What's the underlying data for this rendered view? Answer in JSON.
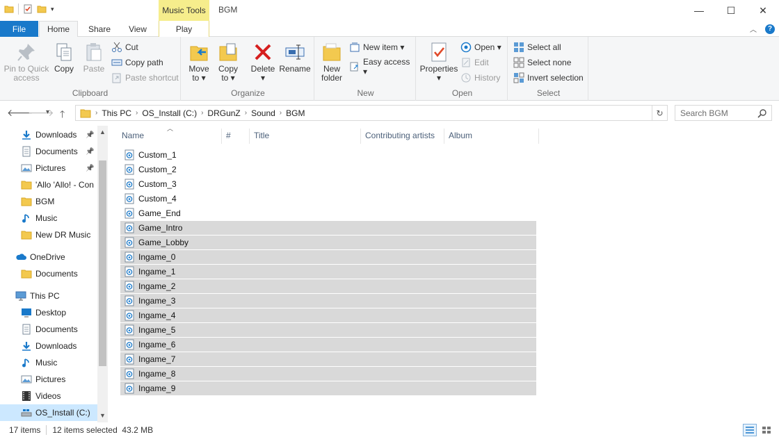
{
  "window": {
    "title": "BGM",
    "context_tab": "Music Tools",
    "controls": {
      "minimize": "—",
      "maximize": "☐",
      "close": "✕"
    }
  },
  "tabs": {
    "file": "File",
    "home": "Home",
    "share": "Share",
    "view": "View",
    "play": "Play"
  },
  "ribbon": {
    "clipboard": {
      "label": "Clipboard",
      "pin_line1": "Pin to Quick",
      "pin_line2": "access",
      "copy": "Copy",
      "paste": "Paste",
      "cut": "Cut",
      "copy_path": "Copy path",
      "paste_shortcut": "Paste shortcut"
    },
    "organize": {
      "label": "Organize",
      "move_to": "Move",
      "move_to2": "to ▾",
      "copy_to": "Copy",
      "copy_to2": "to ▾",
      "delete": "Delete",
      "delete2": "▾",
      "rename": "Rename"
    },
    "new": {
      "label": "New",
      "new_folder": "New",
      "new_folder2": "folder",
      "new_item": "New item ▾",
      "easy_access": "Easy access ▾"
    },
    "open": {
      "label": "Open",
      "properties": "Properties",
      "properties2": "▾",
      "open": "Open ▾",
      "edit": "Edit",
      "history": "History"
    },
    "select": {
      "label": "Select",
      "select_all": "Select all",
      "select_none": "Select none",
      "invert": "Invert selection"
    }
  },
  "address": {
    "path": [
      "This PC",
      "OS_Install (C:)",
      "DRGunZ",
      "Sound",
      "BGM"
    ],
    "search_placeholder": "Search BGM"
  },
  "nav": {
    "items": [
      {
        "label": "Downloads",
        "icon": "download-icon",
        "pinned": true
      },
      {
        "label": "Documents",
        "icon": "documents-icon",
        "pinned": true
      },
      {
        "label": "Pictures",
        "icon": "pictures-icon",
        "pinned": true
      },
      {
        "label": "'Allo 'Allo! - Con",
        "icon": "folder-icon",
        "pinned": false
      },
      {
        "label": "BGM",
        "icon": "folder-icon",
        "pinned": false
      },
      {
        "label": "Music",
        "icon": "music-icon",
        "pinned": false
      },
      {
        "label": "New DR Music",
        "icon": "folder-icon",
        "pinned": false
      },
      {
        "label": "OneDrive",
        "icon": "onedrive-icon",
        "pinned": false
      },
      {
        "label": "Documents",
        "icon": "folder-icon",
        "pinned": false
      },
      {
        "label": "This PC",
        "icon": "computer-icon",
        "pinned": false
      },
      {
        "label": "Desktop",
        "icon": "desktop-icon",
        "pinned": false
      },
      {
        "label": "Documents",
        "icon": "documents-icon",
        "pinned": false
      },
      {
        "label": "Downloads",
        "icon": "download-icon",
        "pinned": false
      },
      {
        "label": "Music",
        "icon": "music-icon",
        "pinned": false
      },
      {
        "label": "Pictures",
        "icon": "pictures-icon",
        "pinned": false
      },
      {
        "label": "Videos",
        "icon": "videos-icon",
        "pinned": false
      },
      {
        "label": "OS_Install (C:)",
        "icon": "drive-icon",
        "pinned": false
      }
    ]
  },
  "columns": {
    "name": "Name",
    "number": "#",
    "title": "Title",
    "artists": "Contributing artists",
    "album": "Album"
  },
  "files": [
    {
      "name": "Custom_1",
      "selected": false
    },
    {
      "name": "Custom_2",
      "selected": false
    },
    {
      "name": "Custom_3",
      "selected": false
    },
    {
      "name": "Custom_4",
      "selected": false
    },
    {
      "name": "Game_End",
      "selected": false
    },
    {
      "name": "Game_Intro",
      "selected": true
    },
    {
      "name": "Game_Lobby",
      "selected": true
    },
    {
      "name": "Ingame_0",
      "selected": true
    },
    {
      "name": "Ingame_1",
      "selected": true
    },
    {
      "name": "Ingame_2",
      "selected": true
    },
    {
      "name": "Ingame_3",
      "selected": true
    },
    {
      "name": "Ingame_4",
      "selected": true
    },
    {
      "name": "Ingame_5",
      "selected": true
    },
    {
      "name": "Ingame_6",
      "selected": true
    },
    {
      "name": "Ingame_7",
      "selected": true
    },
    {
      "name": "Ingame_8",
      "selected": true
    },
    {
      "name": "Ingame_9",
      "selected": true
    }
  ],
  "status": {
    "items": "17 items",
    "selected": "12 items selected  43.2 MB"
  },
  "colors": {
    "accent": "#1979ca",
    "context": "#f6ed8c",
    "selection": "#d9d9d9",
    "nav_selected": "#cce8ff"
  }
}
